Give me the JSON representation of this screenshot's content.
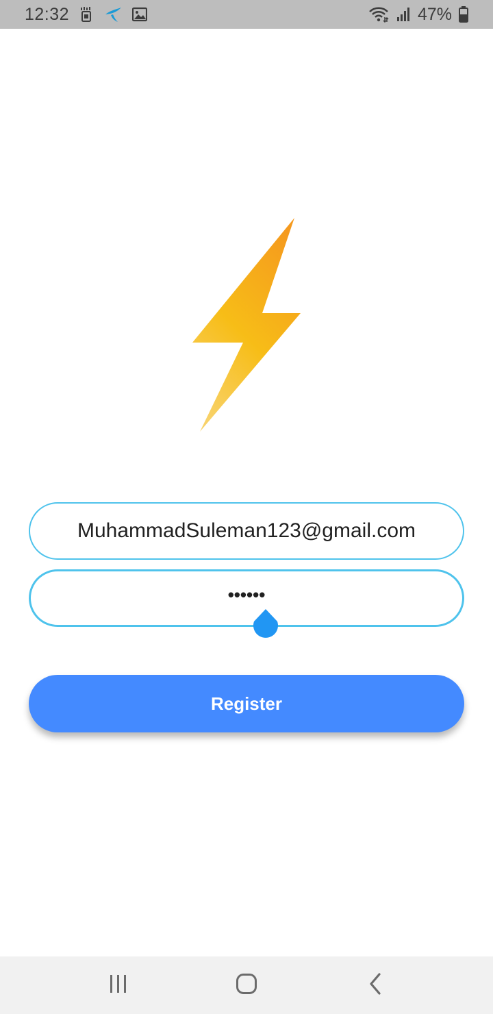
{
  "status_bar": {
    "time": "12:32",
    "battery": "47%",
    "icons": [
      "sim-data-icon",
      "telenor-icon",
      "gallery-icon",
      "wifi-icon",
      "signal-icon",
      "battery-icon"
    ]
  },
  "logo": {
    "icon": "lightning-bolt-icon",
    "colors": {
      "top": "#f59a1e",
      "middle": "#f7bd17",
      "bottom": "#f8d26a"
    }
  },
  "form": {
    "email_value": "MuhammadSuleman123@gmail.com",
    "password_value": "••••••",
    "register_label": "Register"
  },
  "colors": {
    "field_border": "#4fc3ec",
    "button": "#448aff",
    "handle": "#2196f3"
  },
  "nav_bar": {
    "icons": [
      "recents-icon",
      "home-icon",
      "back-icon"
    ]
  }
}
